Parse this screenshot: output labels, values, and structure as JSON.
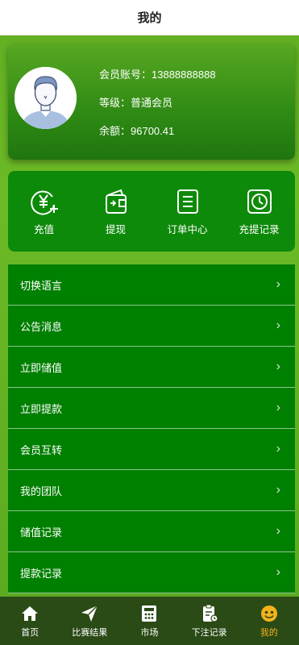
{
  "header": {
    "title": "我的"
  },
  "profile": {
    "account_label": "会员账号：",
    "account_value": "13888888888",
    "level_label": "等级：",
    "level_value": "普通会员",
    "balance_label": "余额：",
    "balance_value": "96700.41"
  },
  "actions": [
    {
      "label": "充值",
      "icon": "yen-plus-icon"
    },
    {
      "label": "提现",
      "icon": "wallet-icon"
    },
    {
      "label": "订单中心",
      "icon": "order-icon"
    },
    {
      "label": "充提记录",
      "icon": "clock-icon"
    }
  ],
  "menu": [
    {
      "label": "切换语言"
    },
    {
      "label": "公告消息"
    },
    {
      "label": "立即储值"
    },
    {
      "label": "立即提款"
    },
    {
      "label": "会员互转"
    },
    {
      "label": "我的团队"
    },
    {
      "label": "储值记录"
    },
    {
      "label": "提款记录"
    }
  ],
  "tabbar": [
    {
      "label": "首页",
      "icon": "home-icon"
    },
    {
      "label": "比赛结果",
      "icon": "send-icon"
    },
    {
      "label": "市场",
      "icon": "market-icon"
    },
    {
      "label": "下注记录",
      "icon": "clipboard-icon"
    },
    {
      "label": "我的",
      "icon": "smile-icon",
      "active": true
    }
  ],
  "colors": {
    "accent": "#008000",
    "tab_active": "#f4b21a",
    "tabbar_bg": "#2a4a16"
  }
}
